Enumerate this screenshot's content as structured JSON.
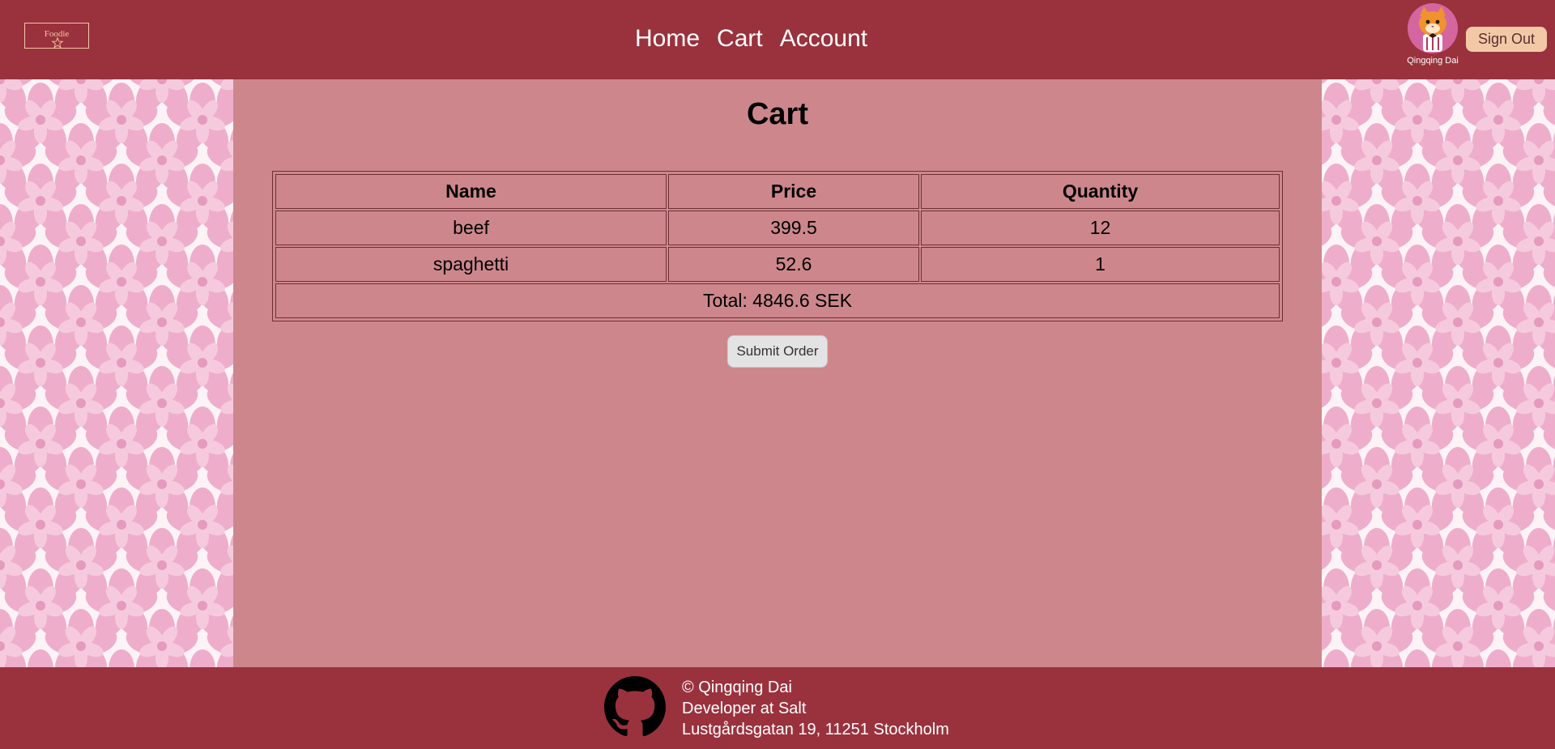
{
  "header": {
    "logo_text": "Foodie",
    "nav": [
      "Home",
      "Cart",
      "Account"
    ],
    "user_name": "Qingqing Dai",
    "sign_out_label": "Sign Out"
  },
  "main": {
    "title": "Cart",
    "table": {
      "headers": [
        "Name",
        "Price",
        "Quantity"
      ],
      "rows": [
        [
          "beef",
          "399.5",
          "12"
        ],
        [
          "spaghetti",
          "52.6",
          "1"
        ]
      ],
      "total": "Total: 4846.6 SEK"
    },
    "submit_label": "Submit Order"
  },
  "footer": {
    "lines": [
      "© Qingqing Dai",
      "Developer at Salt",
      "Lustgårdsgatan 19, 11251 Stockholm"
    ],
    "icon": "github-icon"
  },
  "colors": {
    "header_bg": "#9a323e",
    "main_bg": "#cd878c",
    "accent": "#f3c8a6"
  }
}
